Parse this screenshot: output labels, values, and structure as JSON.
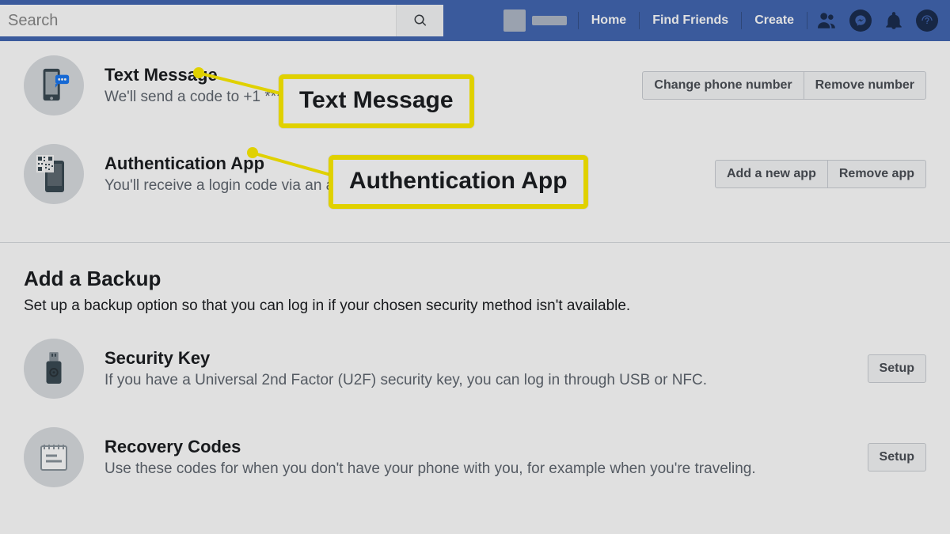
{
  "header": {
    "search_placeholder": "Search",
    "nav": {
      "home": "Home",
      "find_friends": "Find Friends",
      "create": "Create"
    }
  },
  "methods": {
    "text_message": {
      "title": "Text Message",
      "desc": "We'll send a code to +1 ***",
      "change_btn": "Change phone number",
      "remove_btn": "Remove number"
    },
    "auth_app": {
      "title": "Authentication App",
      "desc": "You'll receive a login code via an au",
      "add_btn": "Add a new app",
      "remove_btn": "Remove app"
    }
  },
  "backup": {
    "heading": "Add a Backup",
    "desc": "Set up a backup option so that you can log in if your chosen security method isn't available.",
    "security_key": {
      "title": "Security Key",
      "desc": "If you have a Universal 2nd Factor (U2F) security key, you can log in through USB or NFC.",
      "setup_btn": "Setup"
    },
    "recovery_codes": {
      "title": "Recovery Codes",
      "desc": "Use these codes for when you don't have your phone with you, for example when you're traveling.",
      "setup_btn": "Setup"
    }
  },
  "callouts": {
    "c1": "Text Message",
    "c2": "Authentication App"
  }
}
